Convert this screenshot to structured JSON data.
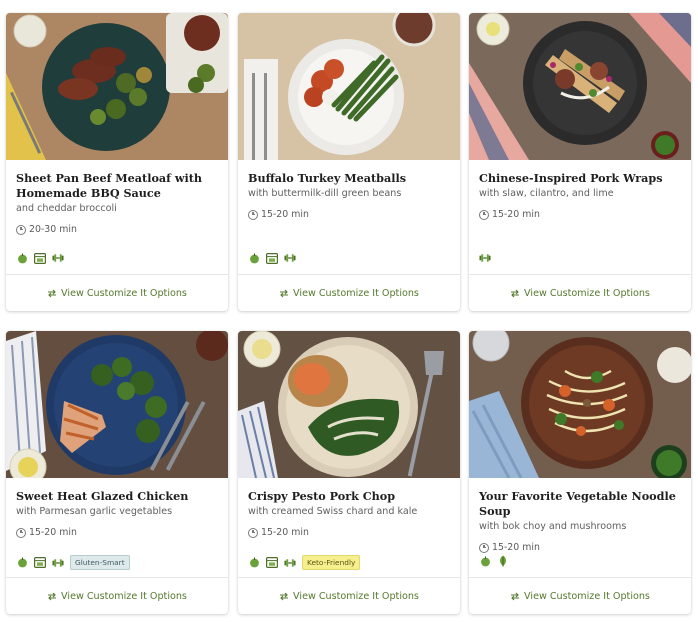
{
  "recipes": [
    {
      "title": "Sheet Pan Beef Meatloaf with Homemade BBQ Sauce",
      "subtitle": "and cheddar broccoli",
      "time": "20-30 min",
      "tags": [
        "apple-icon",
        "oven-icon",
        "dumbbell-icon"
      ],
      "badge": ""
    },
    {
      "title": "Buffalo Turkey Meatballs",
      "subtitle": "with buttermilk-dill green beans",
      "time": "15-20 min",
      "tags": [
        "apple-icon",
        "oven-icon",
        "dumbbell-icon"
      ],
      "badge": ""
    },
    {
      "title": "Chinese-Inspired Pork Wraps",
      "subtitle": "with slaw, cilantro, and lime",
      "time": "15-20 min",
      "tags": [
        "dumbbell-icon"
      ],
      "badge": ""
    },
    {
      "title": "Sweet Heat Glazed Chicken",
      "subtitle": "with Parmesan garlic vegetables",
      "time": "15-20 min",
      "tags": [
        "apple-icon",
        "oven-icon",
        "dumbbell-icon"
      ],
      "badge": "Gluten-Smart"
    },
    {
      "title": "Crispy Pesto Pork Chop",
      "subtitle": "with creamed Swiss chard and kale",
      "time": "15-20 min",
      "tags": [
        "apple-icon",
        "oven-icon",
        "dumbbell-icon"
      ],
      "badge": "Keto-Friendly"
    },
    {
      "title": "Your Favorite Vegetable Noodle Soup",
      "subtitle": "with bok choy and mushrooms",
      "time": "15-20 min",
      "tags": [
        "apple-icon",
        "leaf-icon"
      ],
      "badge": ""
    }
  ],
  "customize_label": "View Customize It Options",
  "colors": {
    "accent_green": "#55792e",
    "gluten_badge": "#dde9ea",
    "keto_badge": "#f6ef8e"
  }
}
